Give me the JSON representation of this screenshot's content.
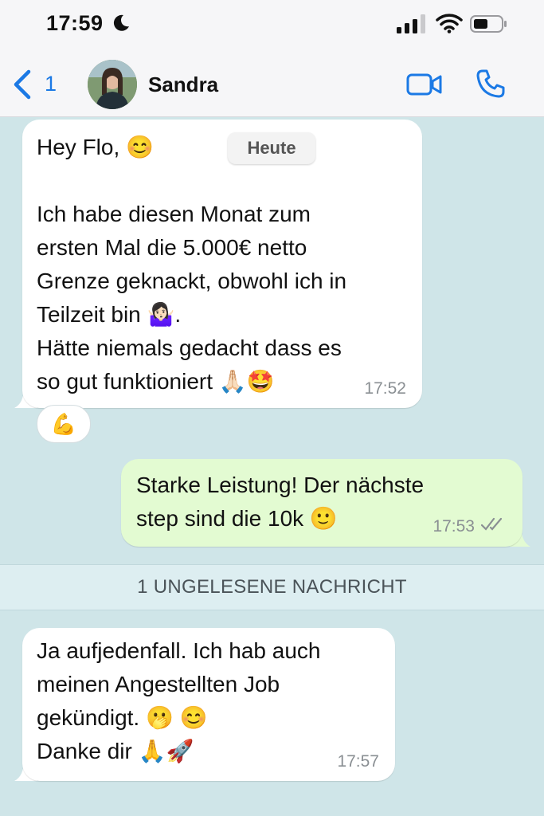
{
  "status_bar": {
    "time": "17:59"
  },
  "header": {
    "back_count": "1",
    "contact_name": "Sandra"
  },
  "messages": [
    {
      "direction": "incoming",
      "text": "Hey Flo, 😊\n\nIch habe diesen Monat zum\nersten Mal die 5.000€ netto\nGrenze geknackt, obwohl ich in\nTeilzeit bin 🤷🏻‍♀️.\nHätte niemals gedacht dass es\nso gut funktioniert 🙏🏻🤩",
      "time": "17:52",
      "reaction": "💪"
    },
    {
      "direction": "outgoing",
      "text": "Starke Leistung! Der nächste\nstep sind die 10k 🙂",
      "time": "17:53"
    },
    {
      "direction": "incoming",
      "text": "Ja aufjedenfall. Ich hab auch\nmeinen Angestellten Job\ngekündigt. 🫢 😊\nDanke dir 🙏🚀",
      "time": "17:57"
    }
  ],
  "date_pill": "Heute",
  "unread_divider": "1 UNGELESENE NACHRICHT",
  "colors": {
    "chat_background": "#cfe5e8",
    "incoming_bubble": "#ffffff",
    "outgoing_bubble": "#e3fbd2",
    "accent": "#1b79e5"
  }
}
